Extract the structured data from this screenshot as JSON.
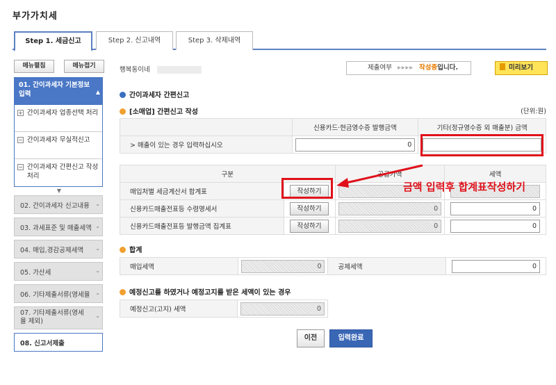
{
  "page_title": "부가가치세",
  "tabs": [
    {
      "label": "Step 1. 세금신고",
      "active": true
    },
    {
      "label": "Step 2. 신고내역",
      "active": false
    },
    {
      "label": "Step 3. 삭제내역",
      "active": false
    }
  ],
  "sidebar": {
    "expand_label": "메뉴펼침",
    "collapse_label": "메뉴접기",
    "active_item": "01. 간이과세자 기본정보 입력",
    "sub_items": [
      {
        "marker": "+",
        "label": "간이과세자 업종선택 처리"
      },
      {
        "marker": "−",
        "label": "간이과세자 무실적신고"
      },
      {
        "marker": "−",
        "label": "간이과세자 간편신고 작성 처리"
      }
    ],
    "items": [
      "02. 간이과세자 신고내용",
      "03. 과세표준 및 매출세액",
      "04. 매입,경감공제세액",
      "05. 가산세",
      "06. 기타제출서류(영세율",
      "07. 기타제출서류(영세율 제외)"
    ],
    "last_item": "08. 신고서제출"
  },
  "header": {
    "company": "행복동이네",
    "status_label": "제출여부",
    "status_arrows": "▸▸▸▸",
    "status_value": "작성중",
    "status_suffix": "입니다.",
    "preview_label": "미리보기"
  },
  "section_main": "간이과세자 간편신고",
  "section_sales": "[소매업] 간편신고 작성",
  "unit_label": "(단위:원)",
  "sales_table": {
    "col1": "신용카드·현금영수증 발행금액",
    "col2": "기타(정규영수증 외 매출분) 금액",
    "row_label": "> 매출이 있는 경우 입력하십시오",
    "value1": "0"
  },
  "purchase_table": {
    "col_category": "구분",
    "col_supply": "공급가액",
    "col_tax": "세액",
    "rows": [
      {
        "label": "매입처별 세금계산서 합계표",
        "button": "작성하기",
        "supply": "",
        "tax": ""
      },
      {
        "label": "신용카드매출전표등 수령명세서",
        "button": "작성하기",
        "supply": "0",
        "tax": "0"
      },
      {
        "label": "신용카드매출전표등 발행금액 집계표",
        "button": "작성하기",
        "supply": "0",
        "tax": "0"
      }
    ]
  },
  "section_total": "합계",
  "total_table": {
    "purchase_tax_label": "매입세액",
    "purchase_tax_value": "0",
    "deduction_label": "공제세액",
    "deduction_value": "0"
  },
  "section_correction": "예정신고를 하였거나 예정고지를 받은 세액이 있는 경우",
  "correction_table": {
    "label": "예정신고(고지) 세액",
    "value": "0"
  },
  "annotation_text": "금액 입력후 합계표작성하기",
  "buttons": {
    "prev": "이전",
    "done": "입력완료"
  },
  "colors": {
    "accent_blue": "#4a77c6",
    "status_orange": "#e87a00",
    "annotation_red": "#e0101a"
  }
}
